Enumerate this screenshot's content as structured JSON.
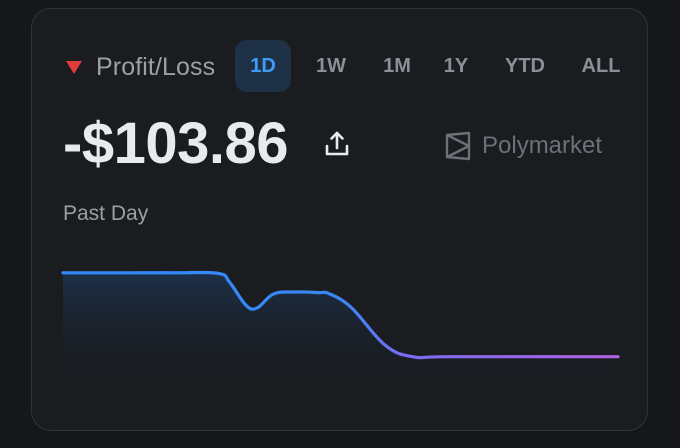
{
  "header": {
    "metric_label": "Profit/Loss",
    "trend_direction": "down",
    "trend_color": "#e23d3d"
  },
  "tabs": [
    {
      "label": "1D",
      "active": true
    },
    {
      "label": "1W",
      "active": false
    },
    {
      "label": "1M",
      "active": false
    },
    {
      "label": "1Y",
      "active": false
    },
    {
      "label": "YTD",
      "active": false
    },
    {
      "label": "ALL",
      "active": false
    }
  ],
  "summary": {
    "value": "-$103.86",
    "share_icon": "share-upload-icon",
    "brand": "Polymarket",
    "brand_icon": "polymarket-logo-icon"
  },
  "period_label": "Past Day",
  "colors": {
    "accent_blue": "#3f9cf6",
    "line_start": "#2f8cff",
    "line_end": "#b061e3"
  },
  "chart_data": {
    "type": "line",
    "title": "",
    "xlabel": "",
    "ylabel": "",
    "x": [
      0,
      0.1,
      0.2,
      0.28,
      0.3,
      0.33,
      0.35,
      0.38,
      0.42,
      0.46,
      0.48,
      0.52,
      0.58,
      0.63,
      0.7,
      1.0
    ],
    "values": [
      0.0,
      0.0,
      0.0,
      -0.5,
      -8,
      -28,
      -30,
      -18,
      -16.5,
      -17,
      -18,
      -30,
      -62,
      -72,
      -72,
      -72
    ],
    "ylim": [
      -80,
      5
    ],
    "grid": false,
    "legend": "none"
  }
}
